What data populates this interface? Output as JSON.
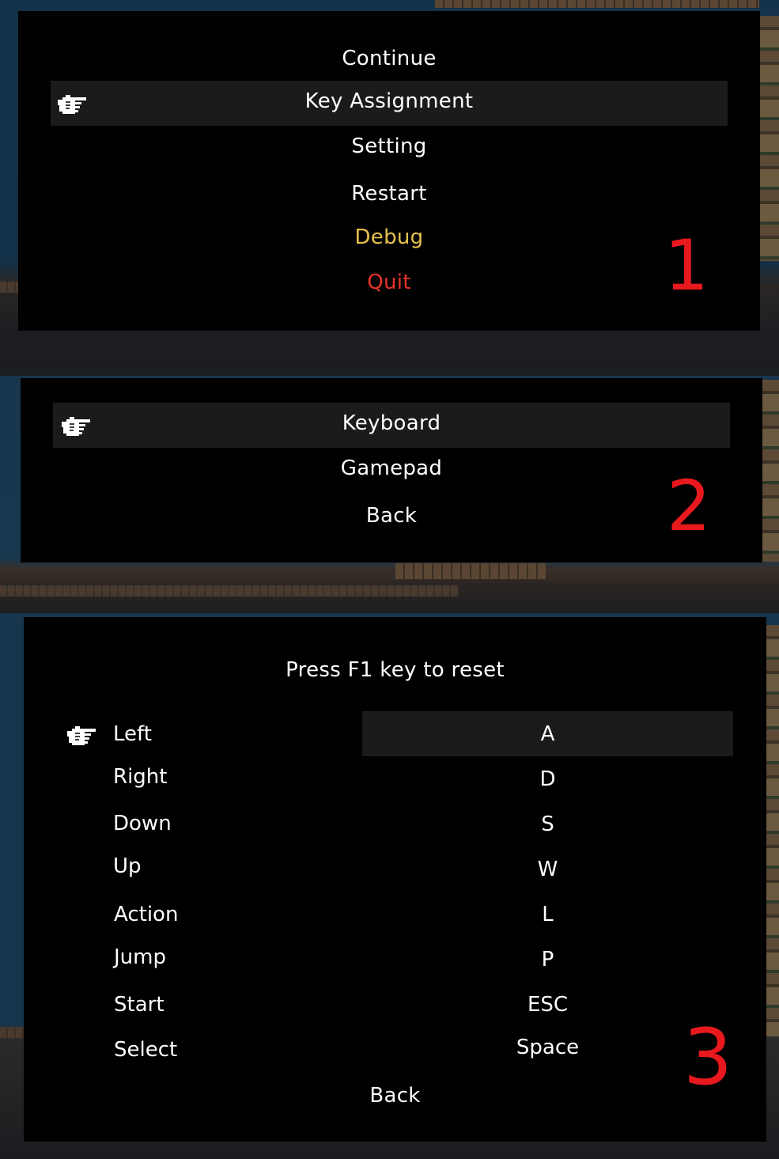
{
  "pause_menu": {
    "items": [
      {
        "label": "Continue",
        "color": "#ffffff"
      },
      {
        "label": "Key Assignment",
        "color": "#ffffff",
        "selected": true
      },
      {
        "label": "Setting",
        "color": "#ffffff"
      },
      {
        "label": "Restart",
        "color": "#ffffff"
      },
      {
        "label": "Debug",
        "color": "#e8c24f"
      },
      {
        "label": "Quit",
        "color": "#e8322a"
      }
    ],
    "annotation": "1"
  },
  "key_assignment_menu": {
    "items": [
      {
        "label": "Keyboard",
        "selected": true
      },
      {
        "label": "Gamepad"
      },
      {
        "label": "Back"
      }
    ],
    "annotation": "2"
  },
  "keyboard_bindings": {
    "hint": "Press F1 key to reset",
    "rows": [
      {
        "action": "Left",
        "key": "A",
        "selected": true
      },
      {
        "action": "Right",
        "key": "D"
      },
      {
        "action": "Down",
        "key": "S"
      },
      {
        "action": "Up",
        "key": "W"
      },
      {
        "action": "Action",
        "key": "L"
      },
      {
        "action": "Jump",
        "key": "P"
      },
      {
        "action": "Start",
        "key": "ESC"
      },
      {
        "action": "Select",
        "key": "Space"
      }
    ],
    "back_label": "Back",
    "annotation": "3"
  },
  "colors": {
    "panel_bg": "#000000",
    "highlight_bg": "#1b1b1b",
    "text": "#ffffff",
    "debug": "#e8c24f",
    "quit": "#e8322a",
    "annotation": "#e8191e"
  },
  "icons": {
    "selection_pointer": "pointing-hand-icon"
  }
}
